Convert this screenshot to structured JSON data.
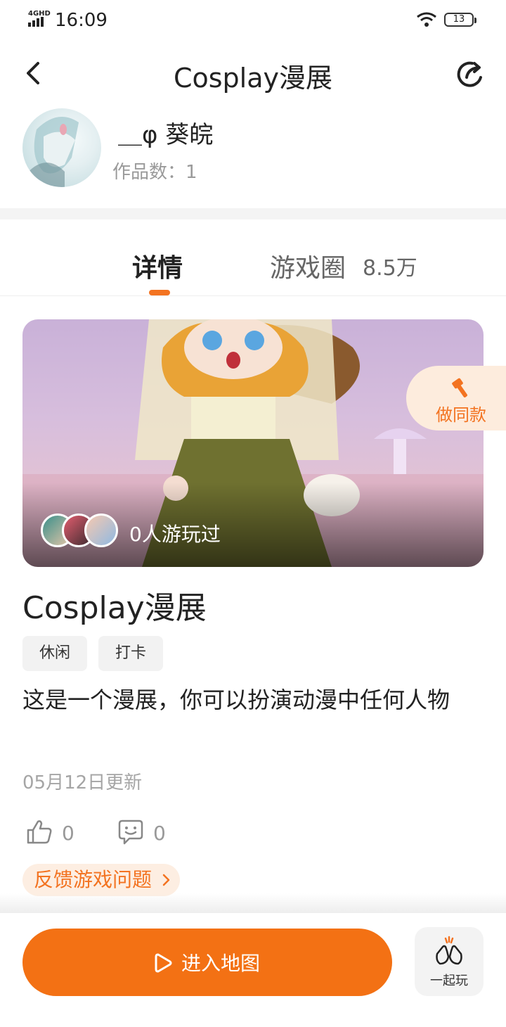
{
  "status_bar": {
    "network": "4GHD",
    "time": "16:09",
    "battery": "13"
  },
  "header": {
    "title": "Cosplay漫展"
  },
  "author": {
    "name": "＿φ 葵皖",
    "works": "作品数：1"
  },
  "tabs": [
    {
      "label": "详情"
    },
    {
      "label": "游戏圈",
      "count": "8.5万"
    }
  ],
  "cover": {
    "played_text": "0人游玩过",
    "make_same": "做同款"
  },
  "game": {
    "title": "Cosplay漫展",
    "tags": [
      "休闲",
      "打卡"
    ],
    "description": "这是一个漫展，你可以扮演动漫中任何人物",
    "updated": "05月12日更新",
    "likes": "0",
    "comments": "0",
    "feedback": "反馈游戏问题"
  },
  "bottom": {
    "enter_map": "进入地图",
    "play_together": "一起玩"
  },
  "colors": {
    "accent": "#f37114",
    "accent_light": "#fdeee2"
  }
}
